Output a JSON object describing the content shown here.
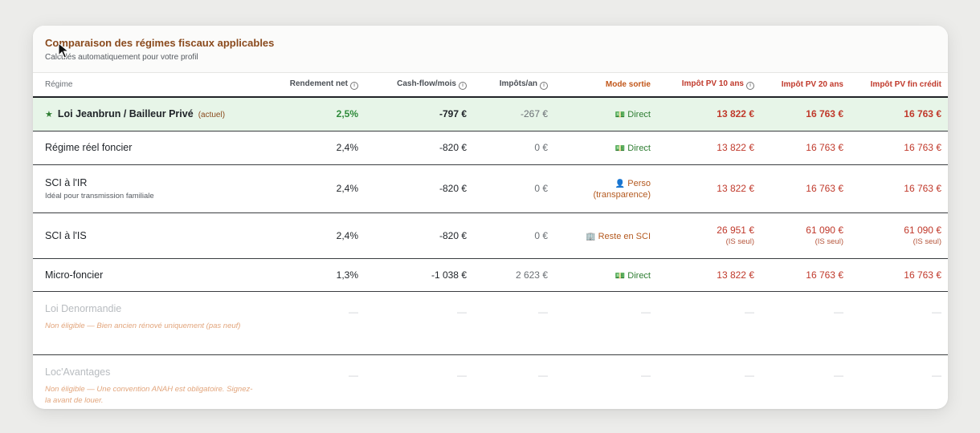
{
  "header": {
    "title": "Comparaison des régimes fiscaux applicables",
    "subtitle": "Calculés automatiquement pour votre profil"
  },
  "columns": {
    "regime": "Régime",
    "rendement": "Rendement net",
    "cashflow": "Cash-flow/mois",
    "impots": "Impôts/an",
    "mode": "Mode sortie",
    "pv10": "Impôt PV 10 ans",
    "pv20": "Impôt PV 20 ans",
    "pvfin": "Impôt PV fin crédit"
  },
  "rows": [
    {
      "name": "Loi Jeanbrun / Bailleur Privé",
      "tag": "(actuel)",
      "rendement": "2,5%",
      "cashflow": "-797 €",
      "impots": "-267 €",
      "mode": "Direct",
      "mode_icon": "cash-icon",
      "pv10": "13 822 €",
      "pv20": "16 763 €",
      "pvfin": "16 763 €"
    },
    {
      "name": "Régime réel foncier",
      "rendement": "2,4%",
      "cashflow": "-820 €",
      "impots": "0 €",
      "mode": "Direct",
      "mode_icon": "cash-icon",
      "pv10": "13 822 €",
      "pv20": "16 763 €",
      "pvfin": "16 763 €"
    },
    {
      "name": "SCI à l'IR",
      "sub": "Idéal pour transmission familiale",
      "rendement": "2,4%",
      "cashflow": "-820 €",
      "impots": "0 €",
      "mode": "Perso",
      "mode_line2": "(transparence)",
      "mode_icon": "person-icon",
      "pv10": "13 822 €",
      "pv20": "16 763 €",
      "pvfin": "16 763 €"
    },
    {
      "name": "SCI à l'IS",
      "rendement": "2,4%",
      "cashflow": "-820 €",
      "impots": "0 €",
      "mode": "Reste en SCI",
      "mode_icon": "building-icon",
      "pv10": "26 951 €",
      "pv20": "61 090 €",
      "pvfin": "61 090 €",
      "pv_note": "(IS seul)"
    },
    {
      "name": "Micro-foncier",
      "rendement": "1,3%",
      "cashflow": "-1 038 €",
      "impots": "2 623 €",
      "mode": "Direct",
      "mode_icon": "cash-icon",
      "pv10": "13 822 €",
      "pv20": "16 763 €",
      "pvfin": "16 763 €"
    },
    {
      "name": "Loi Denormandie",
      "note": "Non éligible — Bien ancien rénové uniquement (pas neuf)",
      "dash": "—"
    },
    {
      "name": "Loc'Avantages",
      "note": "Non éligible — Une convention ANAH est obligatoire. Signez-la avant de louer.",
      "dash": "—"
    }
  ],
  "colors": {
    "title": "#8a4a1d",
    "highlight_row": "#e7f5e8",
    "positive": "#2e8b3a",
    "pv_red": "#c0392b",
    "mode_orange": "#c2571a"
  }
}
